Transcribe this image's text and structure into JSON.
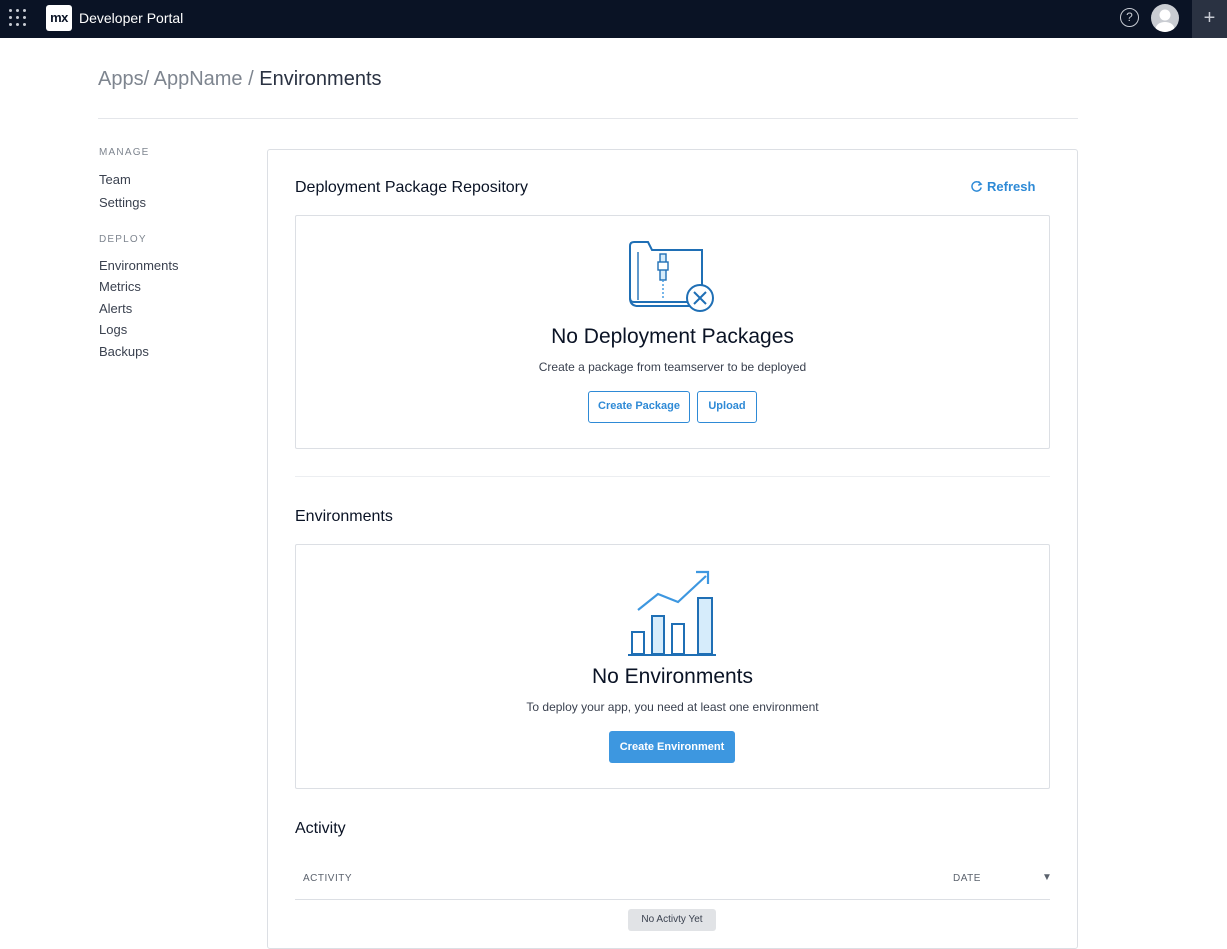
{
  "topbar": {
    "logo_text": "mx",
    "title": "Developer Portal",
    "help_glyph": "?",
    "plus_glyph": "+",
    "icons": [
      "app-grid-icon",
      "help-icon",
      "avatar",
      "plus-icon"
    ]
  },
  "breadcrumb": {
    "apps": "Apps/",
    "app_name": "AppName",
    "separator": "/",
    "current": "Environments"
  },
  "sidebar": {
    "manage_label": "MANAGE",
    "manage_items": [
      "Team",
      "Settings"
    ],
    "deploy_label": "DEPLOY",
    "deploy_items": [
      "Environments",
      "Metrics",
      "Alerts",
      "Logs",
      "Backups"
    ]
  },
  "deployment": {
    "title": "Deployment Package Repository",
    "refresh_label": "Refresh",
    "empty_title": "No Deployment Packages",
    "empty_subtitle": "Create a package from teamserver to be deployed",
    "create_package_label": "Create Package",
    "upload_label": "Upload",
    "icon": "zip-folder-x-icon"
  },
  "environments": {
    "title": "Environments",
    "empty_title": "No Environments",
    "empty_subtitle": "To deploy your app, you need at least one environment",
    "create_label": "Create Environment",
    "icon": "bar-chart-trend-icon"
  },
  "activity": {
    "title": "Activity",
    "columns": [
      "ACTIVITY",
      "DATE"
    ],
    "sort_glyph": "▼",
    "empty_label": "No Activty Yet"
  },
  "colors": {
    "topbar": "#0a1325",
    "accent": "#2e8ad6",
    "primary_button": "#3d97e0",
    "border": "#dcdfe4"
  }
}
